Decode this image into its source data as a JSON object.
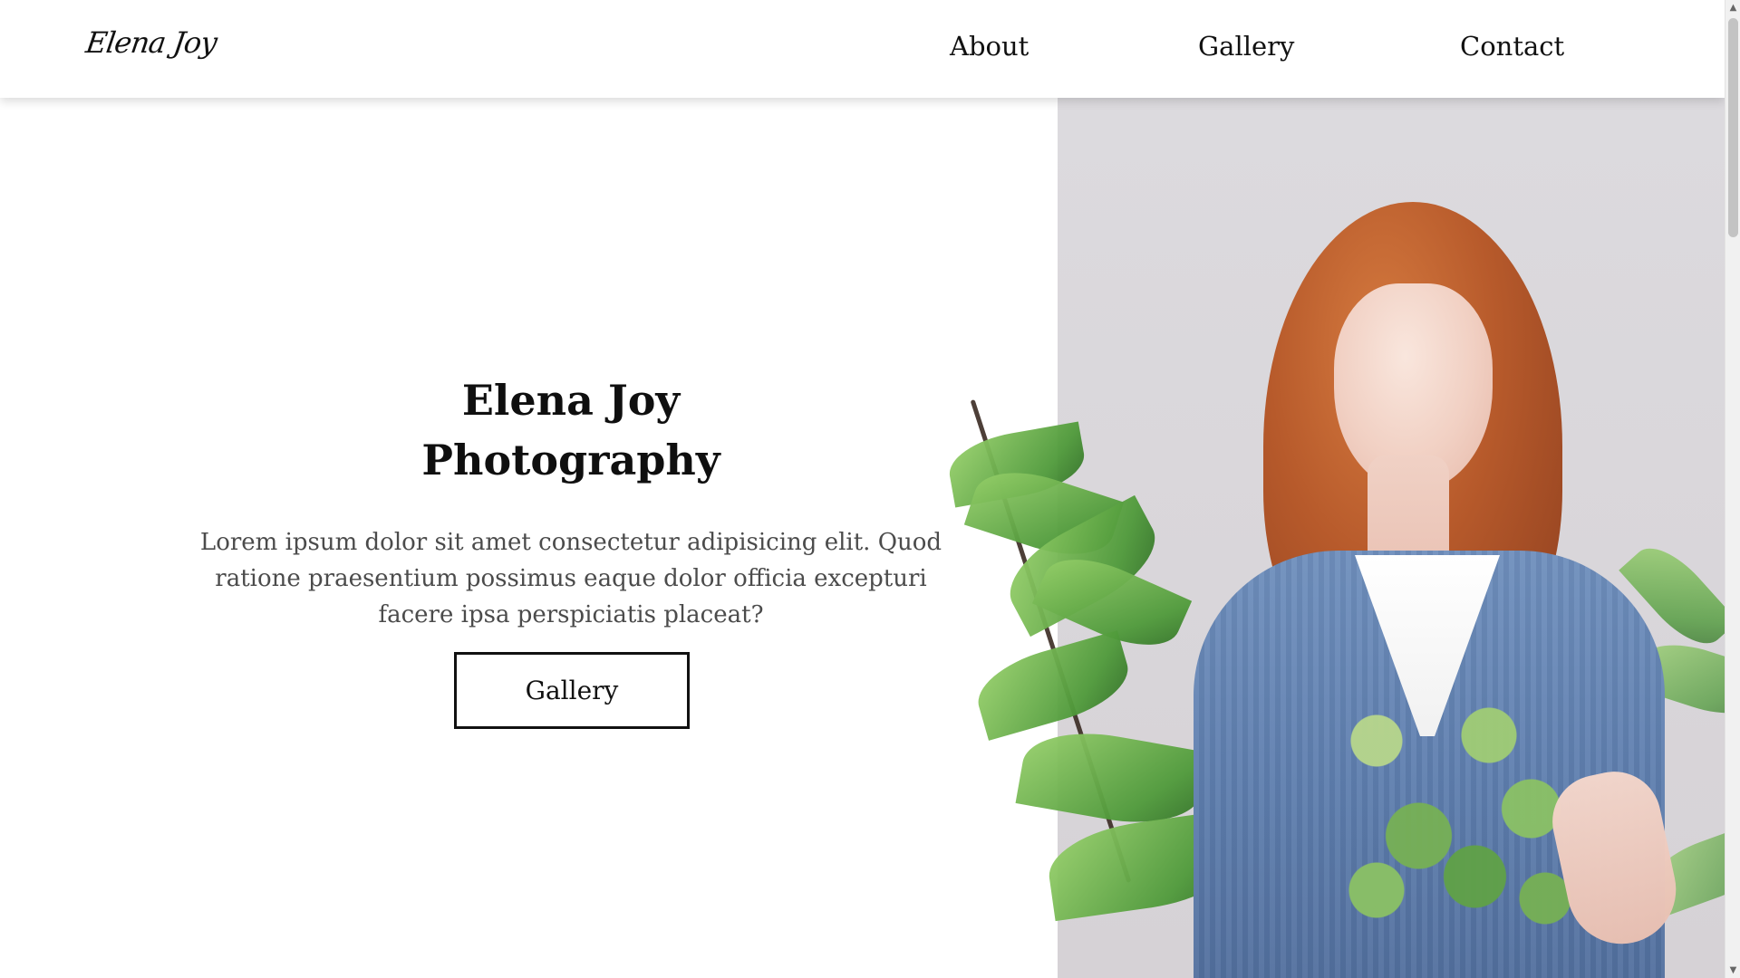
{
  "header": {
    "logo_text": "Elena Joy",
    "nav": [
      {
        "label": "About"
      },
      {
        "label": "Gallery"
      },
      {
        "label": "Contact"
      }
    ]
  },
  "hero": {
    "title": "Elena Joy\nPhotography",
    "description": "Lorem ipsum dolor sit amet consectetur adipisicing elit. Quod ratione praesentium possimus eaque dolor officia excepturi facere ipsa perspiciatis placeat?",
    "button_label": "Gallery"
  },
  "colors": {
    "text_primary": "#111111",
    "text_secondary": "#4b4b4b",
    "photo_bg": "#dcdade",
    "sweater_blue": "#5e7eae",
    "hair_copper": "#b75a2b",
    "leaf_green": "#4f9a3a"
  },
  "icons": {
    "scroll_up": "chevron-up-icon",
    "scroll_down": "chevron-down-icon"
  },
  "scrollbar": {
    "up_glyph": "▲",
    "down_glyph": "▼"
  }
}
